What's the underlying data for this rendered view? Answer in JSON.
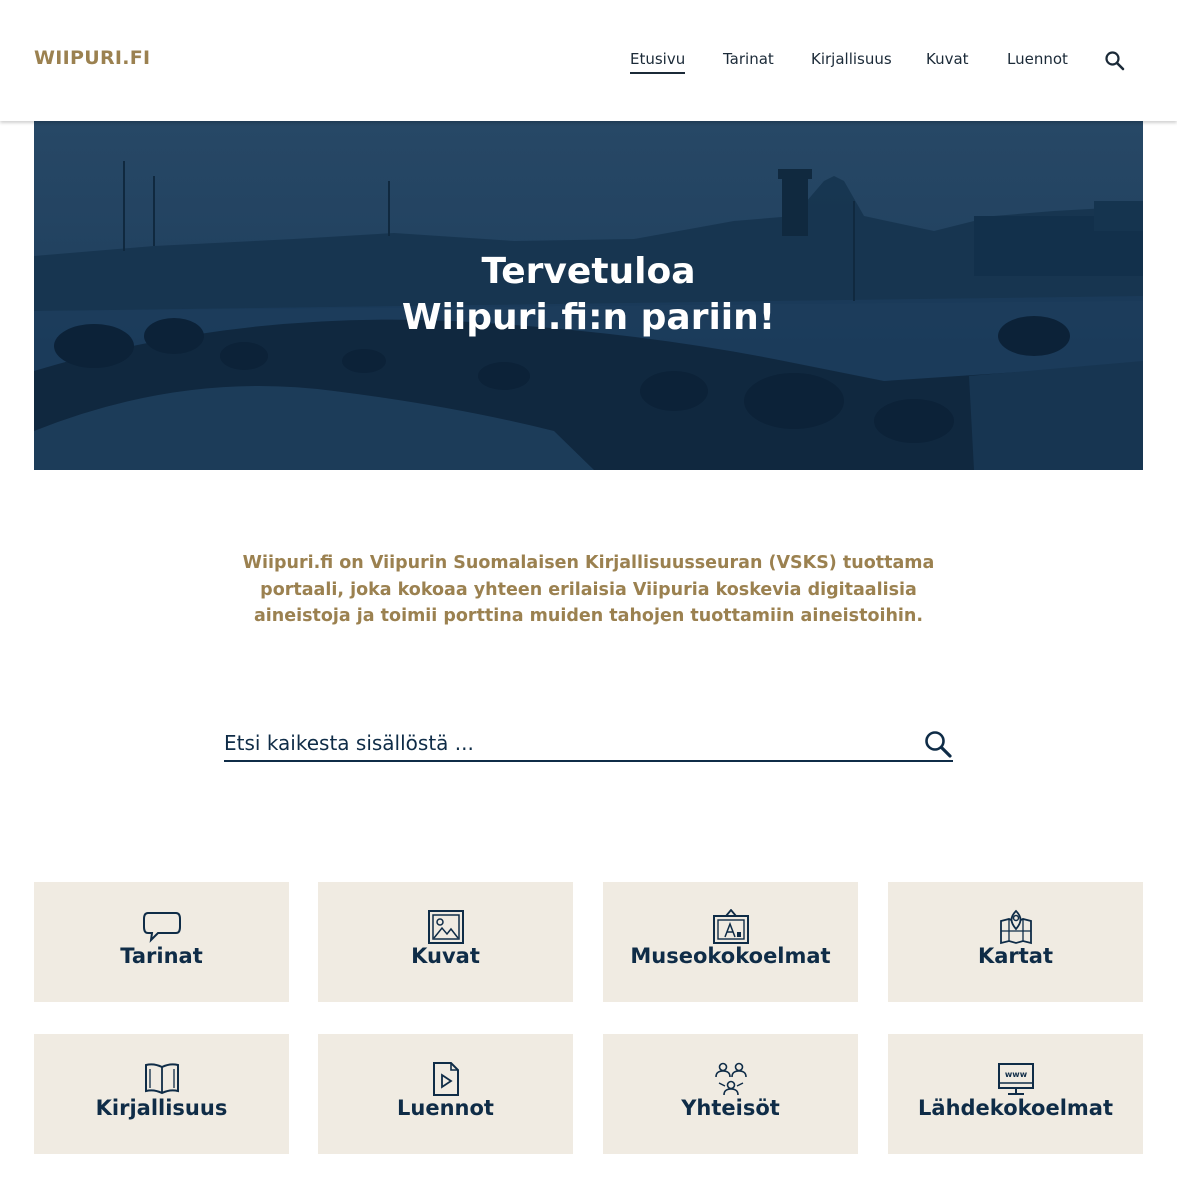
{
  "header": {
    "logo": "WIIPURI.FI",
    "nav": [
      {
        "label": "Etusivu",
        "active": true
      },
      {
        "label": "Tarinat",
        "active": false
      },
      {
        "label": "Kirjallisuus",
        "active": false
      },
      {
        "label": "Kuvat",
        "active": false
      },
      {
        "label": "Luennot",
        "active": false
      }
    ],
    "search_icon": "search-icon"
  },
  "hero": {
    "title_line1": "Tervetuloa",
    "title_line2": "Wiipuri.fi:n pariin!"
  },
  "intro": {
    "text": "Wiipuri.fi on Viipurin Suomalaisen Kirjallisuusseuran (VSKS) tuottama portaali, joka kokoaa yhteen erilaisia Viipuria koskevia digitaalisia aineistoja ja toimii porttina muiden tahojen tuottamiin aineistoihin."
  },
  "search": {
    "placeholder": "Etsi kaikesta sisällöstä ...",
    "icon": "search-icon"
  },
  "tiles": [
    {
      "label": "Tarinat",
      "icon": "speech-bubble-icon"
    },
    {
      "label": "Kuvat",
      "icon": "image-icon"
    },
    {
      "label": "Museokokoelmat",
      "icon": "museum-icon"
    },
    {
      "label": "Kartat",
      "icon": "map-pin-icon"
    },
    {
      "label": "Kirjallisuus",
      "icon": "open-book-icon"
    },
    {
      "label": "Luennot",
      "icon": "play-file-icon"
    },
    {
      "label": "Yhteisöt",
      "icon": "community-icon"
    },
    {
      "label": "Lähdekokoelmat",
      "icon": "www-monitor-icon"
    }
  ],
  "colors": {
    "brand_gold": "#9b8150",
    "navy": "#0f2c47",
    "tile_bg": "#f0ebe2",
    "hero_overlay": "#1d3b59"
  }
}
